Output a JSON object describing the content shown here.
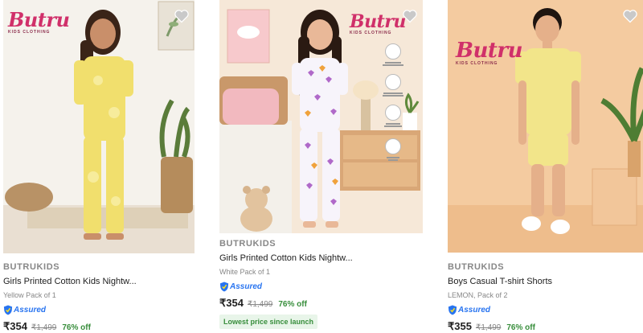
{
  "products": [
    {
      "brand": "BUTRUKIDS",
      "title": "Girls Printed Cotton Kids Nightw...",
      "variant": "Yellow Pack of 1",
      "assured": "Assured",
      "price": "₹354",
      "mrp": "₹1,499",
      "discount": "76% off",
      "logo_text": "Butru",
      "logo_sub": "KIDS CLOTHING"
    },
    {
      "brand": "BUTRUKIDS",
      "title": "Girls Printed Cotton Kids Nightw...",
      "variant": "White Pack of 1",
      "assured": "Assured",
      "price": "₹354",
      "mrp": "₹1,499",
      "discount": "76% off",
      "badge": "Lowest price since launch",
      "logo_text": "Butru",
      "logo_sub": "KIDS CLOTHING"
    },
    {
      "brand": "BUTRUKIDS",
      "title": "Boys Casual T-shirt Shorts",
      "variant": "LEMON, Pack of 2",
      "assured": "Assured",
      "price": "₹355",
      "mrp": "₹1,499",
      "discount": "76% off",
      "logo_text": "Butru",
      "logo_sub": "KIDS CLOTHING"
    }
  ],
  "colors": {
    "brand_pink": "#d0306a",
    "assured_blue": "#2874f0",
    "discount_green": "#388e3c",
    "muted_grey": "#878787"
  },
  "icons": [
    "wishlist-heart-icon",
    "assured-shield-icon",
    "fabric-feature-icon"
  ]
}
